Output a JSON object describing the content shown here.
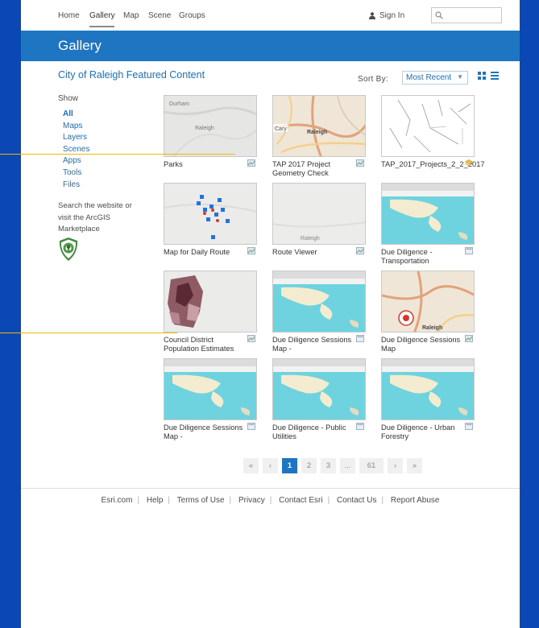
{
  "nav": {
    "items": [
      "Home",
      "Gallery",
      "Map",
      "Scene",
      "Groups"
    ],
    "sign_in": "Sign In",
    "search_placeholder": ""
  },
  "banner": {
    "title": "Gallery"
  },
  "content": {
    "title": "City of Raleigh Featured Content",
    "sort_label": "Sort By:",
    "sort_value": "Most Recent"
  },
  "sidebar": {
    "show_label": "Show",
    "filters": [
      "All",
      "Maps",
      "Layers",
      "Scenes",
      "Apps",
      "Tools",
      "Files"
    ],
    "active_filter": "All",
    "search_note": "Search the website or visit the ArcGIS Marketplace"
  },
  "gallery": {
    "items": [
      {
        "title": "Parks",
        "thumb": "map-raleigh-gray",
        "map_labels": [
          "Durham",
          "Raleigh"
        ],
        "type": "map"
      },
      {
        "title": "TAP 2017 Project Geometry Check",
        "thumb": "map-street",
        "map_labels": [
          "Cary",
          "Raleigh"
        ],
        "type": "map"
      },
      {
        "title": "TAP_2017_Projects_2_2_2017",
        "thumb": "map-lines",
        "type": "layer"
      },
      {
        "title": "Map for Daily Route",
        "thumb": "map-points",
        "type": "map"
      },
      {
        "title": "Route Viewer",
        "thumb": "map-raleigh-gray-2",
        "map_labels": [
          "Raleigh"
        ],
        "type": "map"
      },
      {
        "title": "Due Diligence - Transportation",
        "thumb": "app-browser",
        "type": "app"
      },
      {
        "title": "Council District Population Estimates",
        "thumb": "map-choropleth",
        "type": "map"
      },
      {
        "title": "Due Diligence Sessions Map -",
        "thumb": "app-browser",
        "type": "app"
      },
      {
        "title": "Due Diligence Sessions Map",
        "thumb": "map-street-pin",
        "map_labels": [
          "Raleigh"
        ],
        "type": "map"
      },
      {
        "title": "Due Diligence Sessions Map -",
        "thumb": "app-browser",
        "type": "app"
      },
      {
        "title": "Due Diligence - Public Utilities",
        "thumb": "app-browser",
        "type": "app"
      },
      {
        "title": "Due Diligence - Urban Forestry",
        "thumb": "app-browser",
        "type": "app"
      }
    ]
  },
  "pagination": {
    "first": "«",
    "prev": "‹",
    "pages": [
      "1",
      "2",
      "3",
      "...",
      "61"
    ],
    "current": "1",
    "next": "›",
    "last": "»"
  },
  "footer": {
    "links": [
      "Esri.com",
      "Help",
      "Terms of Use",
      "Privacy",
      "Contact Esri",
      "Contact Us",
      "Report Abuse"
    ]
  },
  "colors": {
    "page_background": "#0b47b5",
    "banner": "#1e75c2",
    "link": "#1d6fb8",
    "callout": "#f5b800"
  }
}
